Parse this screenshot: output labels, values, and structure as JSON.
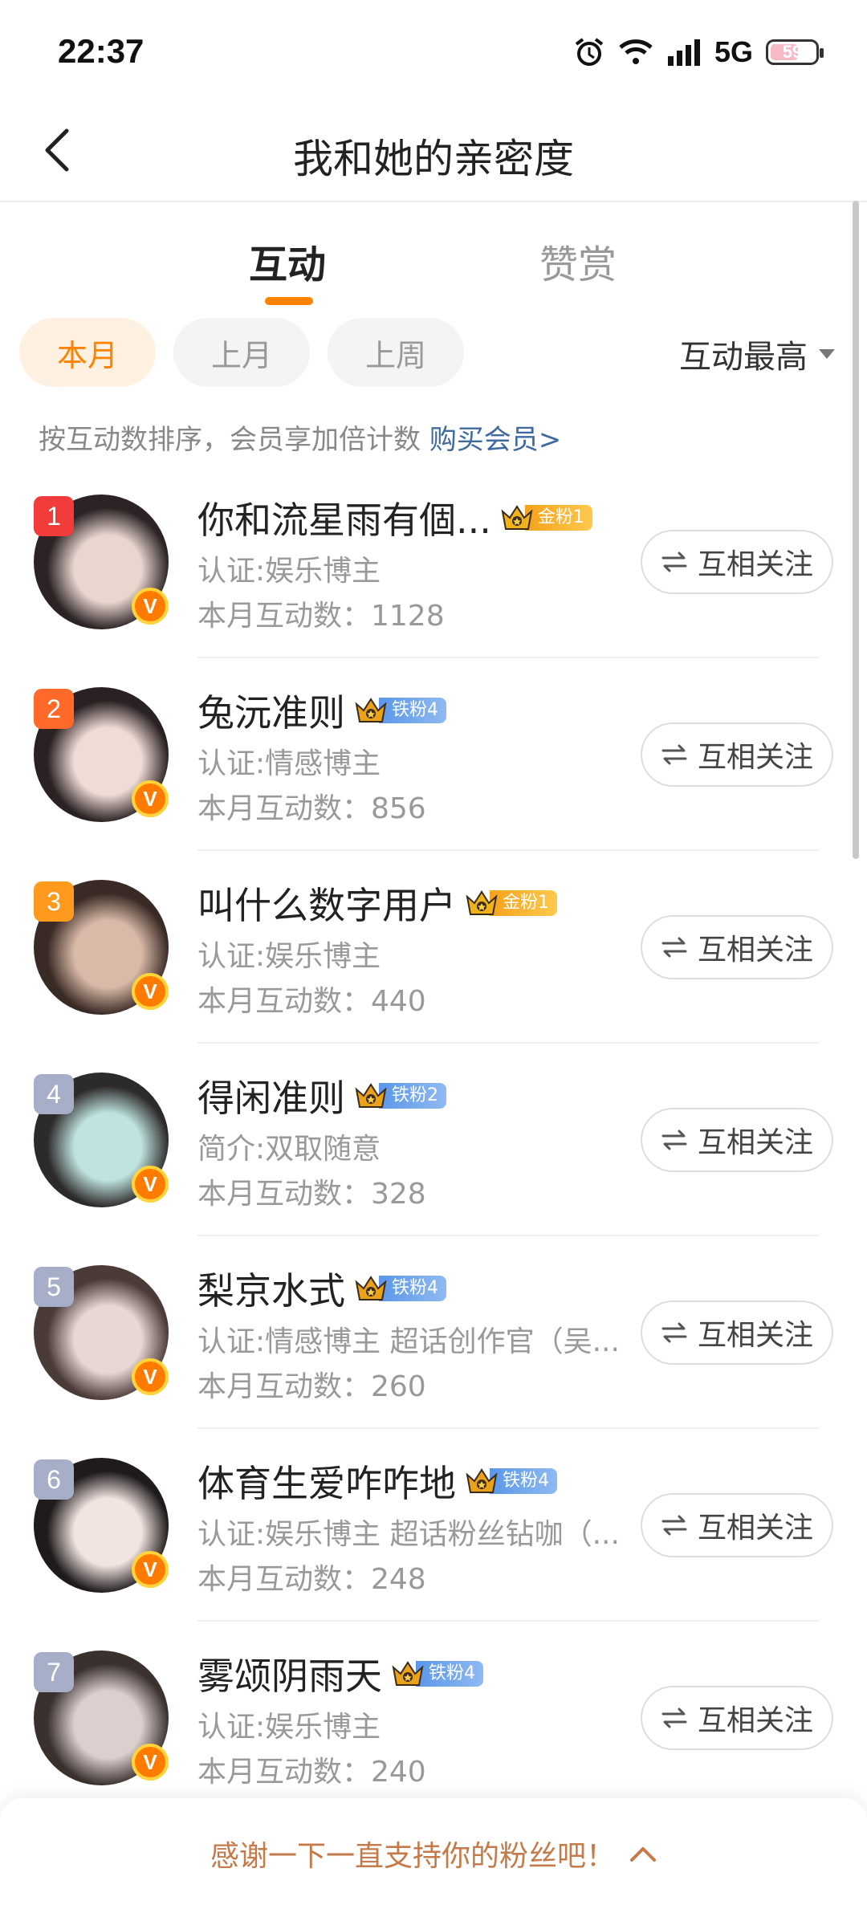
{
  "status": {
    "time": "22:37",
    "network": "5G",
    "battery": "59"
  },
  "header": {
    "title": "我和她的亲密度"
  },
  "tabs": [
    {
      "label": "互动"
    },
    {
      "label": "赞赏"
    }
  ],
  "filters": [
    {
      "label": "本月"
    },
    {
      "label": "上月"
    },
    {
      "label": "上周"
    }
  ],
  "sort": {
    "label": "互动最高"
  },
  "hint": {
    "text": "按互动数排序，会员享加倍计数 ",
    "link": "购买会员>"
  },
  "list": [
    {
      "rank": "1",
      "rank_color": "#f23b3b",
      "name": "你和流星雨有個...",
      "badge": "金粉1",
      "badge_type": "gold",
      "sub": "认证:娱乐博主",
      "count": "本月互动数：1128",
      "follow": "互相关注",
      "avatar_colors": [
        "#2b2324",
        "#e9d6cf"
      ]
    },
    {
      "rank": "2",
      "rank_color": "#ff6a2b",
      "name": "兔沅准则",
      "badge": "铁粉4",
      "badge_type": "iron",
      "sub": "认证:情感博主",
      "count": "本月互动数：856",
      "follow": "互相关注",
      "avatar_colors": [
        "#2a2122",
        "#f0dcd6"
      ]
    },
    {
      "rank": "3",
      "rank_color": "#ff9a1f",
      "name": "叫什么数字用户",
      "badge": "金粉1",
      "badge_type": "gold",
      "sub": "认证:娱乐博主",
      "count": "本月互动数：440",
      "follow": "互相关注",
      "avatar_colors": [
        "#3a2a25",
        "#d9b9a8"
      ]
    },
    {
      "rank": "4",
      "rank_color": "#a6aec8",
      "name": "得闲准则",
      "badge": "铁粉2",
      "badge_type": "iron",
      "sub": "简介:双取随意",
      "count": "本月互动数：328",
      "follow": "互相关注",
      "avatar_colors": [
        "#2d2a2a",
        "#bfe3e0"
      ]
    },
    {
      "rank": "5",
      "rank_color": "#a6aec8",
      "name": "梨京水式",
      "badge": "铁粉4",
      "badge_type": "iron",
      "sub": "认证:情感博主 超话创作官（吴...",
      "count": "本月互动数：260",
      "follow": "互相关注",
      "avatar_colors": [
        "#4a3a38",
        "#e8d8d4"
      ]
    },
    {
      "rank": "6",
      "rank_color": "#a6aec8",
      "name": "体育生爱咋咋地",
      "badge": "铁粉4",
      "badge_type": "iron",
      "sub": "认证:娱乐博主 超话粉丝钻咖（...",
      "count": "本月互动数：248",
      "follow": "互相关注",
      "avatar_colors": [
        "#1f1b1c",
        "#f2e4e0"
      ]
    },
    {
      "rank": "7",
      "rank_color": "#a6aec8",
      "name": "雾颂阴雨天",
      "badge": "铁粉4",
      "badge_type": "iron",
      "sub": "认证:娱乐博主",
      "count": "本月互动数：240",
      "follow": "互相关注",
      "avatar_colors": [
        "#3a302e",
        "#dcd0cf"
      ]
    }
  ],
  "bottom": {
    "text": "感谢一下一直支持你的粉丝吧！"
  },
  "colors": {
    "accent": "#ff8200",
    "link": "#3f6aa1",
    "gold_badge": "#f3a21b",
    "iron_badge": "#5a97e8"
  }
}
